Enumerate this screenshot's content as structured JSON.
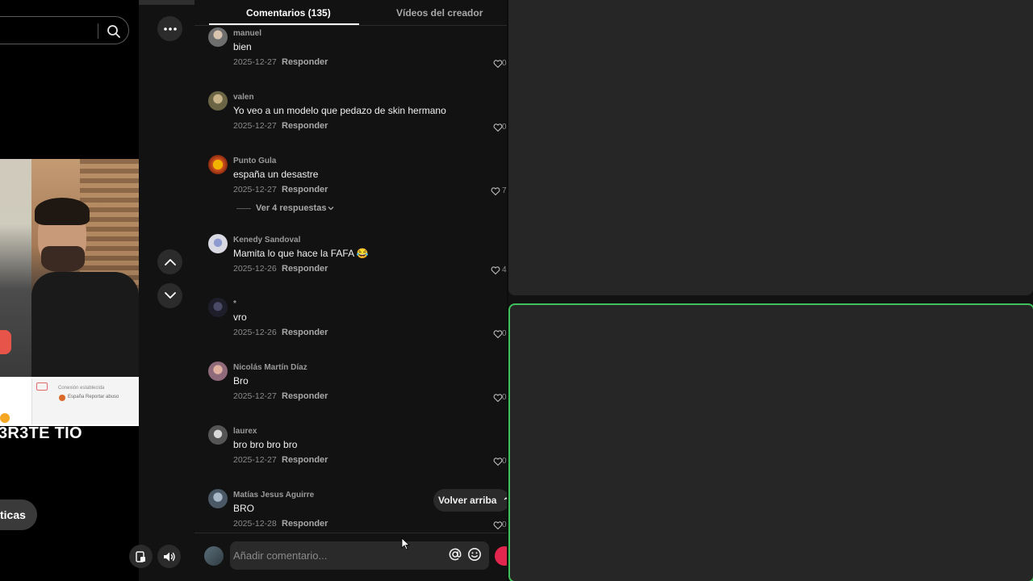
{
  "tabs": {
    "comments": "Comentarios (135)",
    "creator_videos": "Vídeos del creador"
  },
  "video": {
    "caption": "3R3TE TÍO",
    "overlay_text1": "Conexión establecida",
    "overlay_text2": "España  Reportar abuso",
    "pill_label": "ticas"
  },
  "comments": [
    {
      "user": "manuel",
      "text": "bien",
      "date": "2025-12-27",
      "reply": "Responder",
      "likes": "0",
      "avatar_color": "#8a8a8a"
    },
    {
      "user": "valen",
      "text": "Yo veo a un modelo que pedazo de skin hermano",
      "date": "2025-12-27",
      "reply": "Responder",
      "likes": "0",
      "avatar_color": "#9b8a5a"
    },
    {
      "user": "Punto Gula",
      "text": "españa un desastre",
      "date": "2025-12-27",
      "reply": "Responder",
      "likes": "7",
      "avatar_color": "#d4541e"
    },
    {
      "user": "Kenedy Sandoval",
      "text": "Mamita lo que hace la FAFA 😂",
      "date": "2025-12-26",
      "reply": "Responder",
      "likes": "4",
      "avatar_color": "#c7c7d6"
    },
    {
      "user": "*",
      "text": "vro",
      "date": "2025-12-26",
      "reply": "Responder",
      "likes": "0",
      "avatar_color": "#3a3a4a"
    },
    {
      "user": "Nicolás Martín Díaz",
      "text": "Bro",
      "date": "2025-12-27",
      "reply": "Responder",
      "likes": "0",
      "avatar_color": "#b98c8c"
    },
    {
      "user": "laurex",
      "text": "bro bro bro bro",
      "date": "2025-12-27",
      "reply": "Responder",
      "likes": "0",
      "avatar_color": "#9a9a9a"
    },
    {
      "user": "Matías Jesus Aguirre",
      "text": "BRO",
      "date": "2025-12-28",
      "reply": "Responder",
      "likes": "0",
      "avatar_color": "#7a8a9a"
    }
  ],
  "view_replies": "Ver 4 respuestas",
  "back_to_top": "Volver arriba",
  "composer": {
    "placeholder": "Añadir comentario..."
  },
  "colors": {
    "accent_green": "#3fbf5a",
    "post_red": "#e2264d"
  }
}
